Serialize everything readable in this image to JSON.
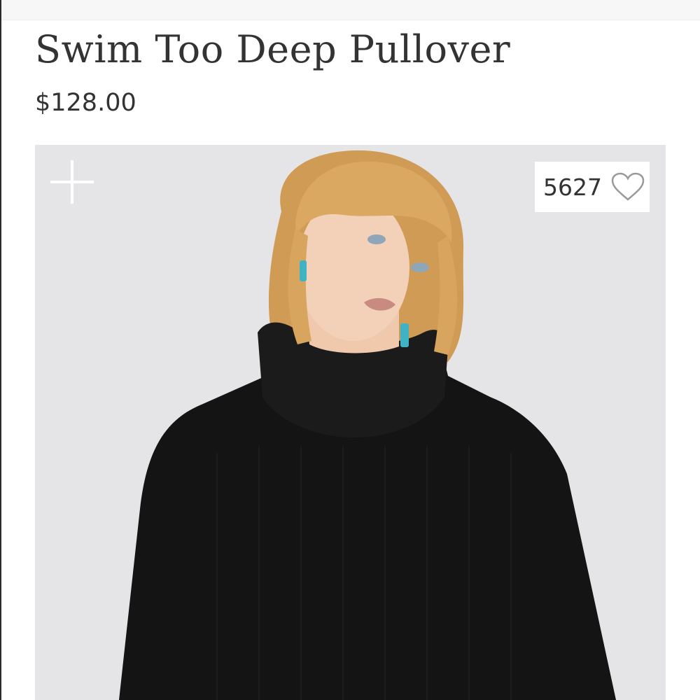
{
  "product": {
    "title": "Swim Too Deep Pullover",
    "price": "$128.00"
  },
  "image": {
    "favorite_count": "5627",
    "zoom_icon": "plus-icon",
    "favorite_icon": "heart-outline-icon"
  },
  "colors": {
    "text": "#333333",
    "image_background": "#e5e5e8",
    "sweater": "#141414",
    "hair": "#d9a55c"
  }
}
